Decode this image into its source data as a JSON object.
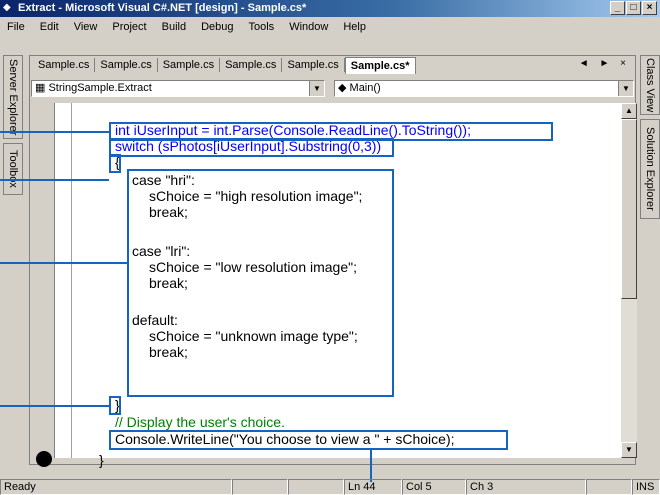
{
  "window": {
    "title": "Extract - Microsoft Visual C#.NET [design] - Sample.cs*",
    "icon": "vs-app-icon",
    "controls": [
      "_",
      "□",
      "×"
    ]
  },
  "menu": [
    "File",
    "Edit",
    "View",
    "Project",
    "Build",
    "Debug",
    "Tools",
    "Window",
    "Help"
  ],
  "left_dock": [
    "Server Explorer",
    "Toolbox"
  ],
  "right_dock": [
    "Class View",
    "Solution Explorer"
  ],
  "doc_tabs": [
    "Sample.cs",
    "Sample.cs",
    "Sample.cs",
    "Sample.cs",
    "Sample.cs",
    "Sample.cs*"
  ],
  "tab_nav": "◄ ► ×",
  "combos": {
    "class": "StringSample.Extract",
    "member": "Main()"
  },
  "code": {
    "l1": "int iUserInput = int.Parse(Console.ReadLine().ToString());",
    "l2": "switch (sPhotos[iUserInput].Substring(0,3))",
    "l3": "{",
    "l4": "case \"hri\":",
    "l5": "sChoice = \"high resolution image\";",
    "l6": "break;",
    "l7": "case \"lri\":",
    "l8": "sChoice = \"low resolution image\";",
    "l9": "break;",
    "l10": "default:",
    "l11": "sChoice = \"unknown image type\";",
    "l12": "break;",
    "l13": "}",
    "l14": "// Display the user's choice.",
    "l15": "Console.WriteLine(\"You choose to view a \" + sChoice);",
    "l16": "}"
  },
  "status": {
    "ready": "Ready",
    "line": "Ln 44",
    "col": "Col 5",
    "ch": "Ch 3",
    "mode": "INS"
  },
  "colors": {
    "callout": "#1565c0",
    "titlebar": "#0a246a"
  }
}
